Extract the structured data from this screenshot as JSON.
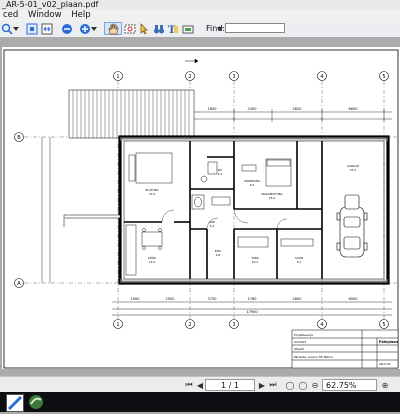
{
  "window": {
    "title": "_AR-5-01_v02_plaan.pdf"
  },
  "menu": {
    "items": [
      "ced",
      "Window",
      "Help"
    ]
  },
  "toolbar": {
    "find_label": "Find:",
    "find_value": ""
  },
  "drawing": {
    "grid_columns": [
      "1",
      "2",
      "3",
      "4",
      "5"
    ],
    "grid_rows": [
      "B",
      "A"
    ],
    "rooms": [
      {
        "name": "ELUTUBA",
        "area": "27.0"
      },
      {
        "name": "MAGAMISTUBA",
        "area": "15.0"
      },
      {
        "name": "GARAAŽ",
        "area": "27.0"
      },
      {
        "name": "KÖÖK",
        "area": "12.0"
      },
      {
        "name": "KOR",
        "area": "5.4"
      },
      {
        "name": "WC",
        "area": "2.3"
      },
      {
        "name": "VANNITUBA",
        "area": "6.2"
      },
      {
        "name": "TUBA",
        "area": "10.2"
      },
      {
        "name": "SAUN",
        "area": "5.1"
      },
      {
        "name": "ESIK",
        "area": "4.8"
      }
    ],
    "title_block": {
      "title": "Põhiplaan",
      "code": "AR-5-01"
    }
  },
  "status": {
    "page": "1 / 1",
    "zoom": "62.75%"
  }
}
